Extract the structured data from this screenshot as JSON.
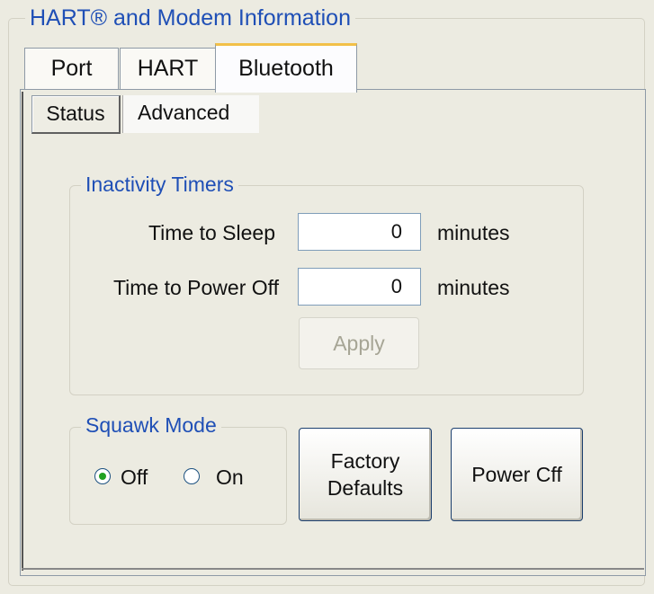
{
  "group": {
    "title": "HART® and Modem Information"
  },
  "tabs": [
    {
      "label": "Port"
    },
    {
      "label": "HART"
    },
    {
      "label": "Bluetooth"
    }
  ],
  "active_tab": "Bluetooth",
  "subtabs": [
    {
      "label": "Status"
    },
    {
      "label": "Advanced"
    }
  ],
  "active_subtab": "Advanced",
  "inactivity": {
    "title": "Inactivity Timers",
    "sleep_label": "Time to Sleep",
    "sleep_value": "0",
    "sleep_unit": "minutes",
    "poweroff_label": "Time to Power Off",
    "poweroff_value": "0",
    "poweroff_unit": "minutes",
    "apply_label": "Apply",
    "apply_enabled": false
  },
  "squawk": {
    "title": "Squawk Mode",
    "options": [
      {
        "label": "Off",
        "selected": true
      },
      {
        "label": "On",
        "selected": false
      }
    ]
  },
  "buttons": {
    "factory_defaults_line1": "Factory",
    "factory_defaults_line2": "Defaults",
    "power_off": "Power Cff"
  },
  "colors": {
    "group_title": "#1f4fb6",
    "active_tab_accent": "#f2c048",
    "radio_selected": "#21a121"
  }
}
